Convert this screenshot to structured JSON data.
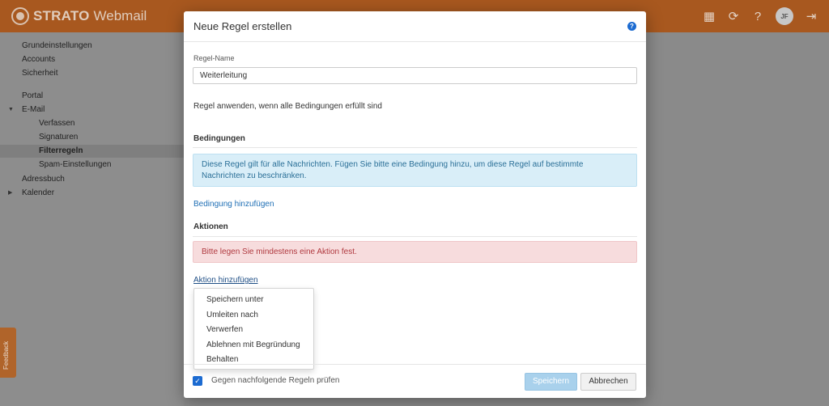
{
  "app": {
    "brand_strato": "STRATO",
    "brand_webmail": "Webmail",
    "user_initials": "JF"
  },
  "top_icons": [
    "apps-grid-icon",
    "refresh-icon",
    "help-icon",
    "user-avatar",
    "logout-icon"
  ],
  "sidebar": {
    "items": [
      {
        "label": "Grundeinstellungen"
      },
      {
        "label": "Accounts"
      },
      {
        "label": "Sicherheit"
      },
      {
        "label": "Portal"
      },
      {
        "label": "E-Mail",
        "expanded": true
      },
      {
        "label": "Verfassen"
      },
      {
        "label": "Signaturen"
      },
      {
        "label": "Filterregeln",
        "active": true
      },
      {
        "label": "Spam-Einstellungen"
      },
      {
        "label": "Adressbuch"
      },
      {
        "label": "Kalender",
        "expanded": false
      }
    ]
  },
  "feedback": {
    "label": "Feedback"
  },
  "modal": {
    "title": "Neue Regel erstellen",
    "rule_name_label": "Regel-Name",
    "rule_name_value": "Weiterleitung",
    "apply_description": "Regel anwenden, wenn alle Bedingungen erfüllt sind",
    "conditions_title": "Bedingungen",
    "conditions_info": "Diese Regel gilt für alle Nachrichten. Fügen Sie bitte eine Bedingung hinzu, um diese Regel auf bestimmte Nachrichten zu beschränken.",
    "add_condition_link": "Bedingung hinzufügen",
    "actions_title": "Aktionen",
    "actions_error": "Bitte legen Sie mindestens eine Aktion fest.",
    "add_action_link": "Aktion hinzufügen",
    "action_options": [
      "Speichern unter",
      "Umleiten nach",
      "Verwerfen",
      "Ablehnen mit Begründung",
      "Behalten"
    ],
    "check_following_label": "Gegen nachfolgende Regeln prüfen",
    "check_following_checked": true,
    "save_label": "Speichern",
    "cancel_label": "Abbrechen"
  },
  "colors": {
    "topbar": "#a8581f",
    "accent": "#1c6bd1",
    "error_bg": "#f7dcdd",
    "info_bg": "#d9eef8"
  }
}
